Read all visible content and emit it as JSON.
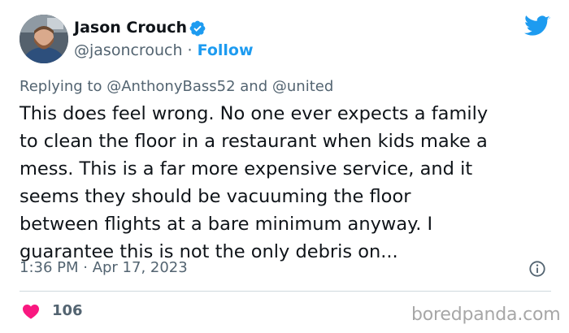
{
  "author": {
    "name": "Jason Crouch",
    "handle": "@jasoncrouch",
    "separator": "·",
    "follow_label": "Follow"
  },
  "reply": {
    "prefix": "Replying to",
    "mention1": "@AnthonyBass52",
    "conjunction": "and",
    "mention2": "@united"
  },
  "tweet": {
    "lines": [
      "This does feel wrong. No one ever expects a family",
      "to clean the floor in a restaurant when kids make a",
      "mess. This is a far more expensive service, and it",
      "seems they should be vacuuming the floor",
      "between flights at a bare minimum anyway. I",
      "guarantee this is not the only debris on..."
    ]
  },
  "timestamp": "1:36 PM · Apr 17, 2023",
  "likes": "106",
  "watermark": "boredpanda.com",
  "icons": {
    "verified": "verified-badge-icon",
    "bird": "twitter-bird-icon",
    "info": "info-icon",
    "heart": "heart-icon"
  },
  "colors": {
    "accent": "#1d9bf0",
    "heart": "#f91880",
    "muted": "#536471",
    "text": "#0f1419"
  }
}
